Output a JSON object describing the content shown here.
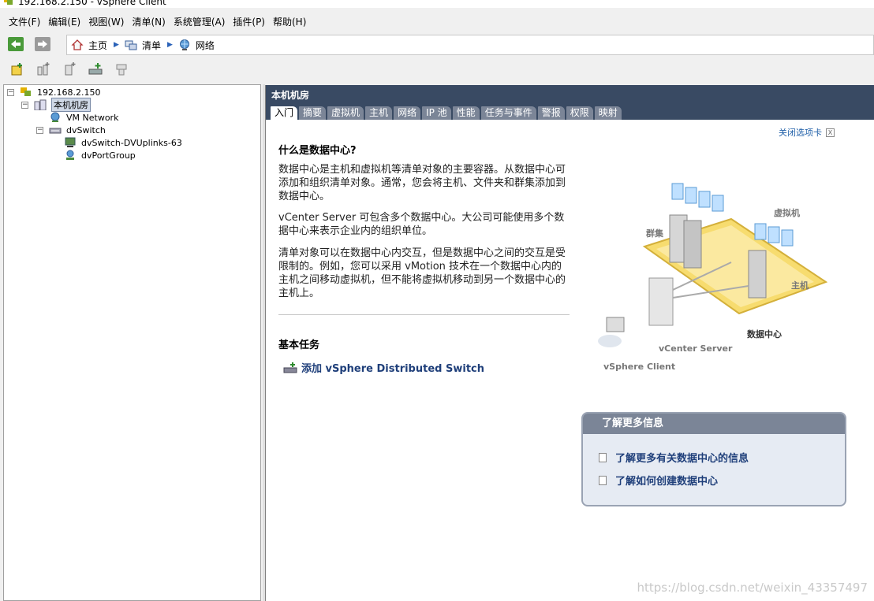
{
  "window": {
    "title": "192.168.2.150 - vSphere Client"
  },
  "menu": [
    "文件(F)",
    "编辑(E)",
    "视图(W)",
    "清单(N)",
    "系统管理(A)",
    "插件(P)",
    "帮助(H)"
  ],
  "breadcrumb": {
    "home": "主页",
    "inventory": "清单",
    "networking": "网络"
  },
  "toolbar": {
    "icons": [
      "new-datacenter-icon",
      "new-folder-icon",
      "new-network-icon",
      "add-switch-icon",
      "migrate-icon"
    ]
  },
  "tree": {
    "root": "192.168.2.150",
    "datacenter": "本机机房",
    "vm_network": "VM Network",
    "dvswitch": "dvSwitch",
    "uplinks": "dvSwitch-DVUplinks-63",
    "portgroup": "dvPortGroup"
  },
  "content": {
    "title": "本机机房",
    "tabs": [
      "入门",
      "摘要",
      "虚拟机",
      "主机",
      "网络",
      "IP 池",
      "性能",
      "任务与事件",
      "警报",
      "权限",
      "映射"
    ],
    "active_tab": "入门",
    "close_tab": "关闭选项卡",
    "question": "什么是数据中心?",
    "para1": "数据中心是主机和虚拟机等清单对象的主要容器。从数据中心可添加和组织清单对象。通常，您会将主机、文件夹和群集添加到数据中心。",
    "para2": "vCenter Server 可包含多个数据中心。大公司可能使用多个数据中心来表示企业内的组织单位。",
    "para3": "清单对象可以在数据中心内交互，但是数据中心之间的交互是受限制的。例如，您可以采用 vMotion 技术在一个数据中心内的主机之间移动虚拟机，但不能将虚拟机移动到另一个数据中心的主机上。",
    "basic_tasks": "基本任务",
    "task_add_switch": "添加 vSphere Distributed Switch",
    "diagram": {
      "cluster": "群集",
      "vm": "虚拟机",
      "host": "主机",
      "datacenter": "数据中心",
      "vcenter": "vCenter Server",
      "client": "vSphere Client"
    },
    "more_info": {
      "title": "了解更多信息",
      "link1": "了解更多有关数据中心的信息",
      "link2": "了解如何创建数据中心"
    }
  },
  "watermark": "https://blog.csdn.net/weixin_43357497"
}
